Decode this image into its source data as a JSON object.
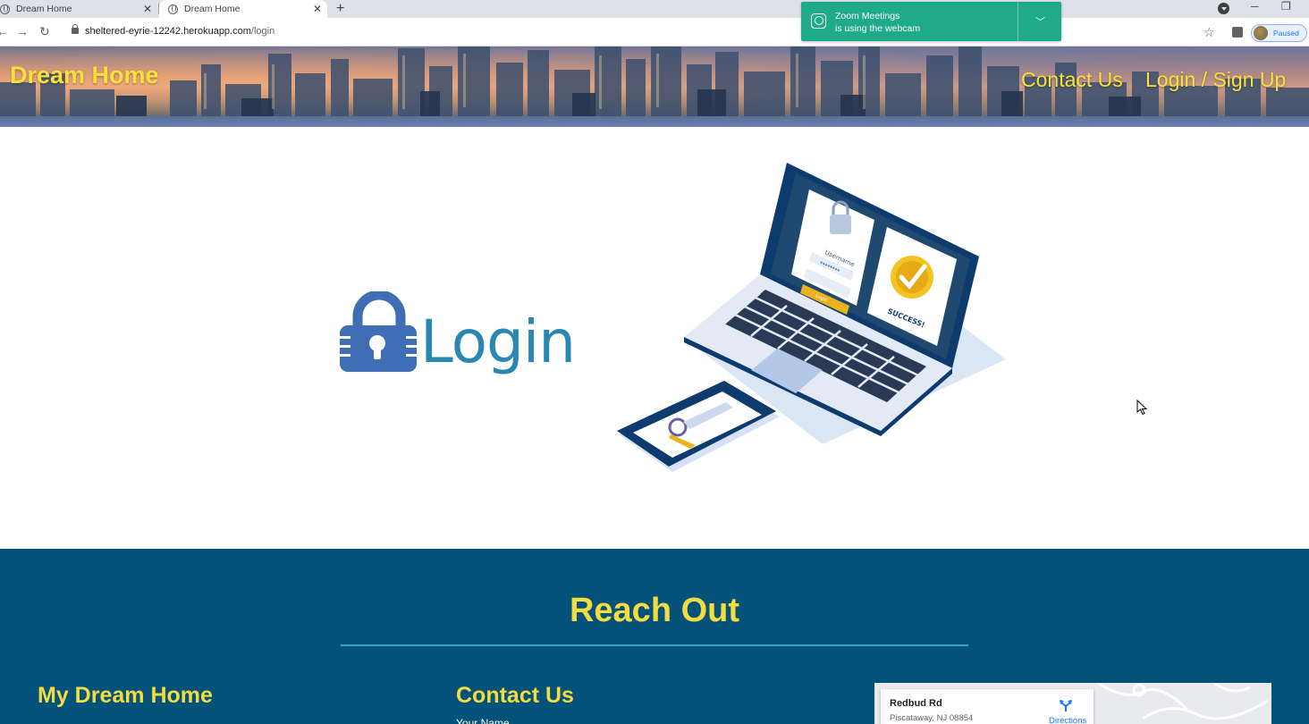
{
  "browser": {
    "tabs": [
      {
        "title": "Dream Home"
      },
      {
        "title": "Dream Home"
      }
    ],
    "url_host": "sheltered-eyrie-12242.herokuapp.com",
    "url_path": "/login",
    "profile_status": "Paused",
    "notification": {
      "line1": "Zoom Meetings",
      "line2": "is using the webcam"
    }
  },
  "header": {
    "brand": "Dream Home",
    "nav": {
      "contact": "Contact Us",
      "login": "Login / Sign Up"
    }
  },
  "hero": {
    "login_text": "Login",
    "laptop_screen": {
      "username": "Username",
      "password": "********",
      "button": "Login",
      "success": "SUCCESS!"
    }
  },
  "footer": {
    "title": "Reach Out",
    "col1_heading": "My Dream Home",
    "col2_heading": "Contact Us",
    "name_label": "Your Name",
    "map": {
      "road": "Redbud Rd",
      "address": "Piscataway, NJ 08854",
      "directions": "Directions"
    }
  },
  "colors": {
    "accent_yellow": "#f7e13a",
    "footer_bg": "#04517a",
    "login_blue": "#2a87b2",
    "toast_green": "#1fab89"
  }
}
